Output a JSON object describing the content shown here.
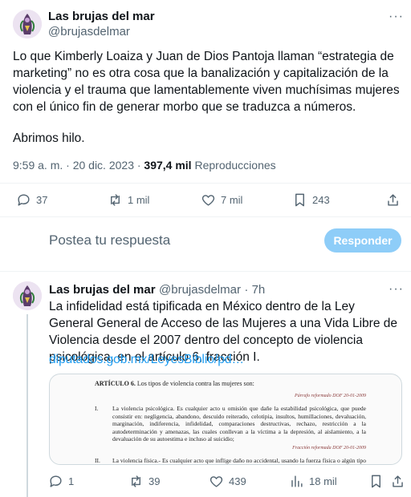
{
  "tweet": {
    "author_name": "Las brujas del mar",
    "author_handle": "@brujasdelmar",
    "more": "···",
    "text": "Lo que Kimberly Loaiza y Juan de Dios Pantoja llaman “estrategia de marketing” no es otra cosa que la banalización y capitalización de la violencia y el trauma que lamentablemente viven muchísimas mujeres con el único fin de generar morbo que se traduzca a números.",
    "text2": "Abrimos hilo.",
    "time": "9:59 a. m. · 20 dic. 2023 ·",
    "views_count": "397,4 mil",
    "views_label": "Reproducciones",
    "actions": {
      "replies": "37",
      "reposts": "1 mil",
      "likes": "7 mil",
      "bookmarks": "243"
    }
  },
  "reply_box": {
    "placeholder": "Postea tu respuesta",
    "button": "Responder"
  },
  "reply": {
    "author_name": "Las brujas del mar",
    "author_handle": "@brujasdelmar",
    "time": "· 7h",
    "more": "···",
    "text": "La infidelidad está tipificada en México dentro de la Ley General General de Acceso de las Mujeres a una Vida Libre de Violencia desde el 2007 dentro del concepto de violencia psicológica, en el artículo 6, fracción I.",
    "link": "diputados.gob.mx/LeyesBiblio/pd…",
    "document": {
      "heading_bold": "ARTÍCULO 6.",
      "heading_rest": " Los tipos de violencia contra las mujeres son:",
      "note1": "Párrafo reformado DOF 20-01-2009",
      "item1_num": "I.",
      "item1_text": "La violencia psicológica. Es cualquier acto u omisión que dañe la estabilidad psicológica, que puede consistir en: negligencia, abandono, descuido reiterado, celotipia, insultos, humillaciones, devaluación, marginación, indiferencia, infidelidad, comparaciones destructivas, rechazo, restricción a la autodeterminación y amenazas, las cuales conllevan a la víctima a la depresión, al aislamiento, a la devaluación de su autoestima e incluso al suicidio;",
      "note2": "Fracción reformada DOF 20-01-2009",
      "item2_num": "II.",
      "item2_text": "La violencia física.- Es cualquier acto que inflige daño no accidental, usando la fuerza física o algún tipo de arma, objeto, ácido o sustancia corrosiva, cáustica, irritante, tóxica o inflamable o cualquier otra sustancia que, en determinadas condiciones, pueda provocar o no lesiones ya"
    },
    "actions": {
      "replies": "1",
      "reposts": "39",
      "likes": "439",
      "views": "18 mil"
    }
  },
  "colors": {
    "accent": "#1d9bf0",
    "reply_button": "#8ecdf8",
    "secondary_text": "#536471"
  }
}
